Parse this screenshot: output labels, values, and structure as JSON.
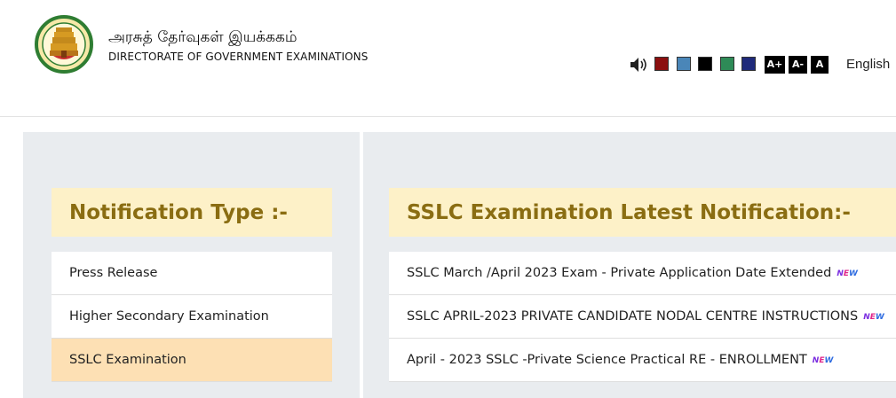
{
  "header": {
    "title_tamil": "அரசுத் தேர்வுகள் இயக்ககம்",
    "title_english": "DIRECTORATE OF GOVERNMENT EXAMINATIONS",
    "logo_icon": "tamil-nadu-emblem-icon",
    "language_link": "English"
  },
  "toolbar": {
    "speaker_icon": "speaker-icon",
    "theme_colors": [
      "#8b0f0f",
      "#4a86b8",
      "#000000",
      "#2e8b57",
      "#1f2a7a"
    ],
    "font_buttons": [
      "A+",
      "A-",
      "A"
    ]
  },
  "left_panel": {
    "heading": "Notification Type :-",
    "items": [
      {
        "label": "Press Release",
        "active": false
      },
      {
        "label": "Higher Secondary Examination",
        "active": false
      },
      {
        "label": "SSLC Examination",
        "active": true
      }
    ]
  },
  "right_panel": {
    "heading": "SSLC Examination Latest Notification:-",
    "new_badge": "NEW",
    "items": [
      {
        "label": "SSLC March /April 2023 Exam - Private Application Date Extended",
        "is_new": true
      },
      {
        "label": "SSLC APRIL-2023 PRIVATE CANDIDATE NODAL CENTRE INSTRUCTIONS",
        "is_new": true
      },
      {
        "label": "April - 2023 SSLC -Private Science Practical RE - ENROLLMENT",
        "is_new": true
      }
    ]
  }
}
